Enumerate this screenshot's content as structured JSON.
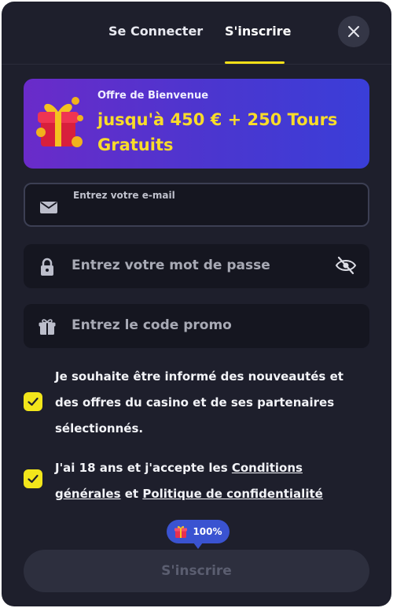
{
  "tabs": {
    "login": "Se Connecter",
    "register": "S'inscrire",
    "active": "register"
  },
  "banner": {
    "subtitle": "Offre de Bienvenue",
    "headline": "jusqu'à 450 € + 250 Tours Gratuits",
    "icon": "gift-icon"
  },
  "form": {
    "email": {
      "label": "Entrez votre e-mail",
      "value": "",
      "icon": "envelope-icon"
    },
    "password": {
      "placeholder": "Entrez votre mot de passe",
      "icon": "lock-icon",
      "toggle_icon": "eye-off-icon"
    },
    "promo": {
      "placeholder": "Entrez le code promo",
      "icon": "gift-icon"
    }
  },
  "consents": {
    "marketing": {
      "checked": true,
      "text": "Je souhaite être informé des nouveautés et des offres du casino et de ses partenaires sélectionnés."
    },
    "terms": {
      "checked": true,
      "text_before": "J'ai 18 ans et j'accepte les ",
      "terms_link": "Conditions générales",
      "text_and": " et ",
      "privacy_link": "Politique de confidentialité"
    }
  },
  "progress": {
    "percent_label": "100%",
    "value": 100
  },
  "submit": {
    "label": "S'inscrire"
  },
  "colors": {
    "background": "#1e1f2c",
    "accent": "#f6e018",
    "banner_start": "#6a2bc9",
    "banner_end": "#3a3ed8",
    "headline": "#f8dc2a",
    "badge": "#3a53d1"
  }
}
